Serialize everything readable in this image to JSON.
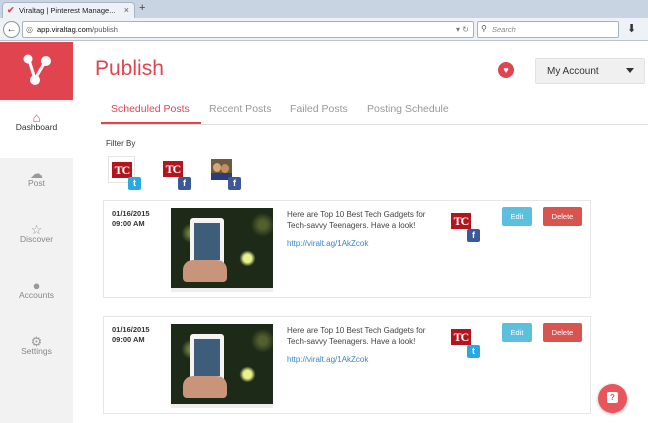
{
  "browser": {
    "tab_title": "Viraltag | Pinterest Manage...",
    "tab_close": "×",
    "new_tab": "+",
    "url_domain": "app.viraltag.com",
    "url_path": "/publish",
    "search_placeholder": "Search"
  },
  "sidebar": {
    "items": [
      {
        "label": "Dashboard",
        "icon": "home-icon",
        "glyph": "⌂",
        "active": true
      },
      {
        "label": "Post",
        "icon": "cloud-upload-icon",
        "glyph": "☁",
        "active": false
      },
      {
        "label": "Discover",
        "icon": "star-icon",
        "glyph": "☆",
        "active": false
      },
      {
        "label": "Accounts",
        "icon": "user-icon",
        "glyph": "●",
        "active": false
      },
      {
        "label": "Settings",
        "icon": "gear-icon",
        "glyph": "⚙",
        "active": false
      }
    ]
  },
  "header": {
    "title": "Publish",
    "account_label": "My Account"
  },
  "tabs": [
    {
      "label": "Scheduled Posts",
      "active": true
    },
    {
      "label": "Recent Posts",
      "active": false
    },
    {
      "label": "Failed Posts",
      "active": false
    },
    {
      "label": "Posting Schedule",
      "active": false
    }
  ],
  "filter": {
    "label": "Filter By",
    "accounts": [
      {
        "mark": "TC",
        "network": "twitter",
        "badge": "t"
      },
      {
        "mark": "TC",
        "network": "facebook",
        "badge": "f"
      },
      {
        "mark": "",
        "network": "facebook",
        "badge": "f"
      }
    ]
  },
  "posts": [
    {
      "date": "01/16/2015",
      "time": "09:00 AM",
      "text": "Here are Top 10 Best Tech Gadgets for Tech-savvy Teenagers. Have a look!",
      "link": "http://viralt.ag/1AkZcok",
      "network": "facebook",
      "badge": "f",
      "edit_label": "Edit",
      "delete_label": "Delete"
    },
    {
      "date": "01/16/2015",
      "time": "09:00 AM",
      "text": "Here are Top 10 Best Tech Gadgets for Tech-savvy Teenagers. Have a look!",
      "link": "http://viralt.ag/1AkZcok",
      "network": "twitter",
      "badge": "t",
      "edit_label": "Edit",
      "delete_label": "Delete"
    }
  ],
  "colors": {
    "brand": "#e0454f",
    "edit": "#5bc0de",
    "delete": "#d9534f",
    "link": "#3a86c8",
    "twitter": "#2aa9e0",
    "facebook": "#3b5998"
  }
}
